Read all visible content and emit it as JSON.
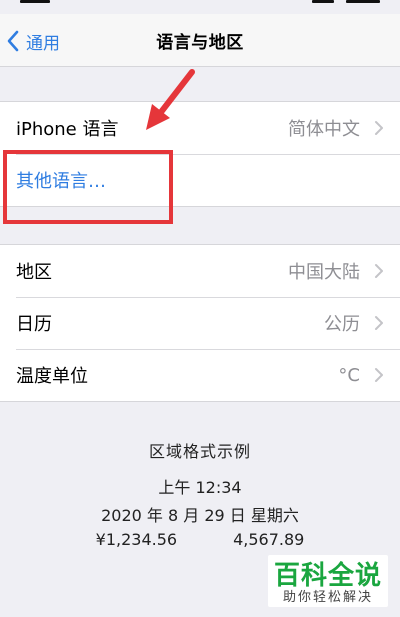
{
  "nav": {
    "back_label": "通用",
    "title": "语言与地区"
  },
  "language_group": {
    "iphone_language_label": "iPhone 语言",
    "iphone_language_value": "简体中文",
    "other_languages_label": "其他语言…"
  },
  "region_group": {
    "rows": [
      {
        "label": "地区",
        "value": "中国大陆"
      },
      {
        "label": "日历",
        "value": "公历"
      },
      {
        "label": "温度单位",
        "value": "°C"
      }
    ]
  },
  "format_example": {
    "title": "区域格式示例",
    "time": "上午 12:34",
    "date": "2020 年 8 月 29 日 星期六",
    "currency": "¥1,234.56",
    "number": "4,567.89"
  },
  "watermark": {
    "main": "百科全说",
    "sub": "助你轻松解决"
  },
  "colors": {
    "accent": "#2f7de1",
    "annotation": "#e5363a",
    "watermark": "#1aa63f"
  },
  "icons": [
    "chevron-left-icon",
    "chevron-right-icon",
    "annotation-arrow-icon"
  ]
}
